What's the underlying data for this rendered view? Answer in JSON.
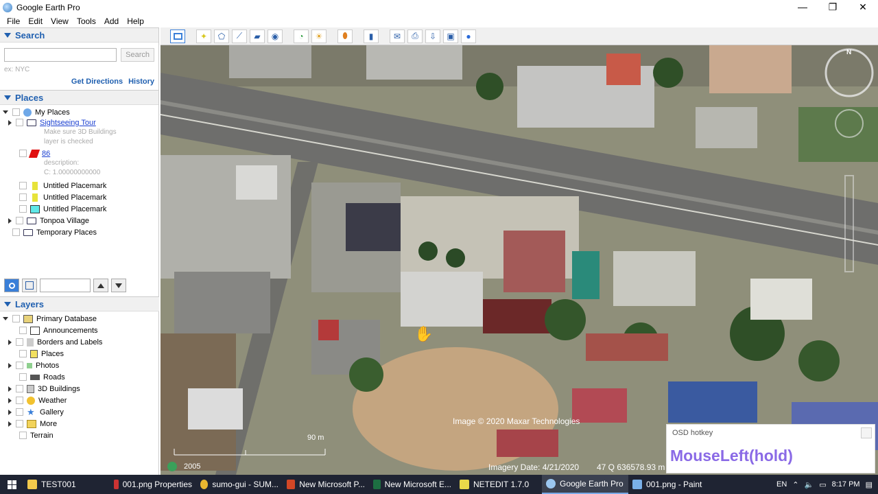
{
  "window": {
    "title": "Google Earth Pro",
    "minimize": "—",
    "maximize": "❐",
    "close": "✕"
  },
  "menu": [
    "File",
    "Edit",
    "View",
    "Tools",
    "Add",
    "Help"
  ],
  "search": {
    "header": "Search",
    "placeholder": "",
    "button": "Search",
    "hint": "ex: NYC",
    "get_directions": "Get Directions",
    "history": "History"
  },
  "places": {
    "header": "Places",
    "items": {
      "my_places": "My Places",
      "sightseeing": "Sightseeing Tour",
      "sightseeing_desc1": "Make sure 3D Buildings",
      "sightseeing_desc2": "layer is checked",
      "item86": "86",
      "item86_desc1": "description:",
      "item86_desc2": "C: 1.00000000000",
      "placemark1": "Untitled Placemark",
      "placemark2": "Untitled Placemark",
      "placemark3": "Untitled Placemark",
      "tonpoa": "Tonpoa Village",
      "temporary": "Temporary Places"
    }
  },
  "layers": {
    "header": "Layers",
    "items": {
      "primary": "Primary Database",
      "announcements": "Announcements",
      "borders": "Borders and Labels",
      "places": "Places",
      "photos": "Photos",
      "roads": "Roads",
      "buildings": "3D Buildings",
      "weather": "Weather",
      "gallery": "Gallery",
      "more": "More",
      "terrain": "Terrain"
    }
  },
  "map": {
    "copyright": "Image © 2020 Maxar Technologies",
    "scale": "90 m",
    "year": "2005",
    "imagery_date": "Imagery Date: 4/21/2020",
    "coords": "47 Q 636578.93 m",
    "compass_n": "N"
  },
  "osd": {
    "label": "OSD hotkey",
    "value": "MouseLeft(hold)"
  },
  "taskbar": {
    "items": [
      "TEST001",
      "001.png Properties",
      "sumo-gui - SUM...",
      "New Microsoft P...",
      "New Microsoft E...",
      "NETEDIT 1.7.0",
      "Google Earth Pro",
      "001.png - Paint"
    ],
    "lang": "EN",
    "time": "8:17 PM"
  }
}
